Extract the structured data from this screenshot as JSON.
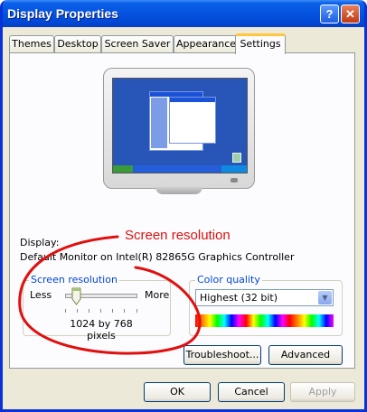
{
  "window": {
    "title": "Display Properties"
  },
  "titlebar": {
    "help_label": "?",
    "close_label": "✕"
  },
  "tabs": [
    {
      "label": "Themes"
    },
    {
      "label": "Desktop"
    },
    {
      "label": "Screen Saver"
    },
    {
      "label": "Appearance"
    },
    {
      "label": "Settings",
      "active": true
    }
  ],
  "annotation": {
    "text": "Screen resolution",
    "color": "#e01010"
  },
  "display": {
    "label": "Display:",
    "value": "Default Monitor on Intel(R) 82865G Graphics Controller"
  },
  "screen_resolution": {
    "group_label": "Screen resolution",
    "less_label": "Less",
    "more_label": "More",
    "value": "1024 by 768 pixels",
    "slider_level": 0.15
  },
  "color_quality": {
    "group_label": "Color quality",
    "selected": "Highest (32 bit)"
  },
  "buttons": {
    "troubleshoot": "Troubleshoot...",
    "advanced": "Advanced",
    "ok": "OK",
    "cancel": "Cancel",
    "apply": "Apply"
  },
  "colors": {
    "titlebar": "#0553e0",
    "accent_tab": "#ffc83c",
    "group_label": "#0046d5"
  }
}
